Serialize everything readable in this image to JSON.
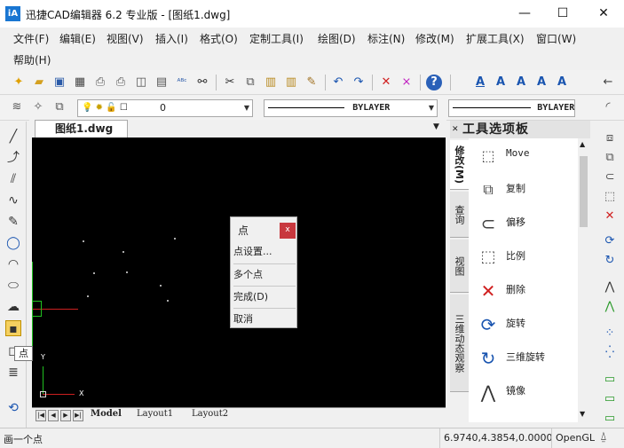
{
  "title": {
    "app_icon": "iA",
    "text": "迅捷CAD编辑器 6.2 专业版  - [图纸1.dwg]",
    "minimize": "—",
    "maximize": "☐",
    "close": "✕"
  },
  "menu": [
    "文件(F)",
    "编辑(E)",
    "视图(V)",
    "插入(I)",
    "格式(O)",
    "定制工具(I)",
    "绘图(D)",
    "标注(N)",
    "修改(M)",
    "扩展工具(X)",
    "窗口(W)",
    "帮助(H)"
  ],
  "layer": {
    "name": "0",
    "linetype": "BYLAYER",
    "lineweight": "BYLAYER"
  },
  "document_tab": {
    "label": "图纸1.dwg",
    "close": "✕"
  },
  "layout_tabs": [
    "Model",
    "Layout1",
    "Layout2"
  ],
  "popup": {
    "title": "点",
    "close": "x",
    "items": [
      "点设置...",
      "多个点",
      "完成(D)",
      "取消"
    ]
  },
  "tooltip": "点",
  "palette": {
    "title": "工具选项板",
    "tabs": [
      "修改(M)",
      "查询",
      "视图",
      "三维动态观察"
    ],
    "tools": [
      {
        "icon": "move-icon",
        "label": "Move"
      },
      {
        "icon": "copy-icon",
        "label": "复制"
      },
      {
        "icon": "offset-icon",
        "label": "偏移"
      },
      {
        "icon": "scale-icon",
        "label": "比例"
      },
      {
        "icon": "delete-icon",
        "label": "删除"
      },
      {
        "icon": "rotate-icon",
        "label": "旋转"
      },
      {
        "icon": "rotate-3d-icon",
        "label": "三维旋转"
      },
      {
        "icon": "mirror-icon",
        "label": "镜像"
      }
    ]
  },
  "status": {
    "prompt": "画一个点",
    "coords": "6.9740,4.3854,0.0000",
    "renderer": "OpenGL"
  },
  "axis": {
    "x": "X",
    "y": "Y"
  },
  "colors": {
    "canvas": "#000000",
    "accent": "#1976d2",
    "close_red": "#c8383e"
  }
}
